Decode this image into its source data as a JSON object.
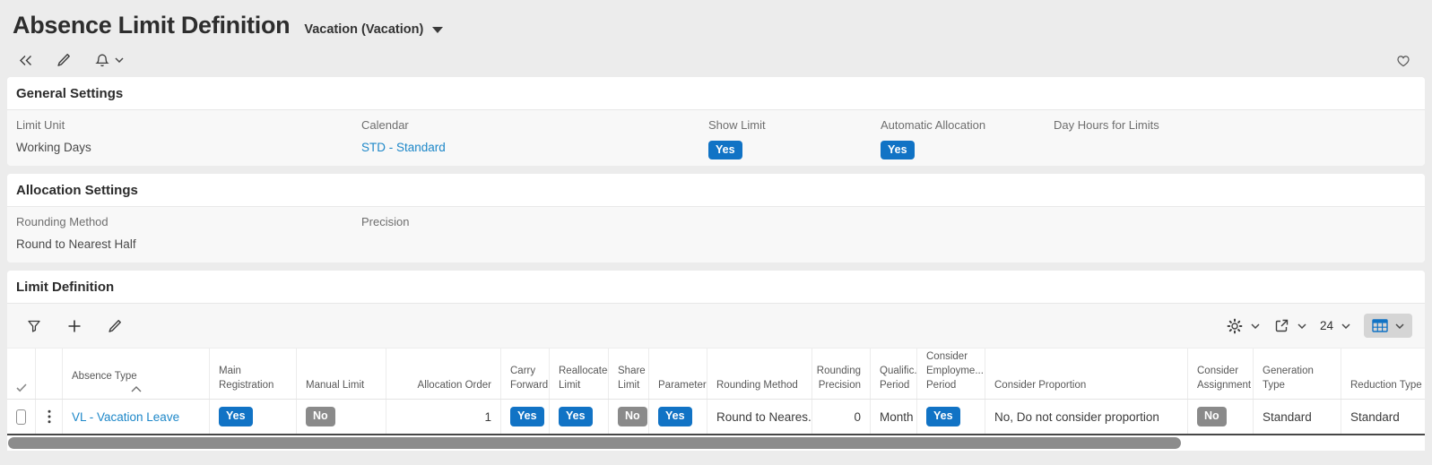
{
  "page": {
    "title": "Absence Limit Definition",
    "context": "Vacation (Vacation)"
  },
  "general_settings": {
    "title": "General Settings",
    "fields": [
      {
        "label": "Limit Unit",
        "value": "Working Days",
        "type": "text"
      },
      {
        "label": "Calendar",
        "value": "STD - Standard",
        "type": "link"
      },
      {
        "label": "Show Limit",
        "value": "Yes",
        "type": "badge"
      },
      {
        "label": "Automatic Allocation",
        "value": "Yes",
        "type": "badge"
      },
      {
        "label": "Day Hours for Limits",
        "value": "",
        "type": "text"
      }
    ]
  },
  "allocation_settings": {
    "title": "Allocation Settings",
    "fields": [
      {
        "label": "Rounding Method",
        "value": "Round to Nearest Half",
        "type": "text"
      },
      {
        "label": "Precision",
        "value": "",
        "type": "text"
      }
    ]
  },
  "limit_definition": {
    "title": "Limit Definition",
    "toolbar": {
      "page_size": "24"
    },
    "table": {
      "columns": [
        "",
        "",
        "Absence Type",
        "Main Registration",
        "Manual Limit",
        "Allocation Order",
        "Carry Forward",
        "Reallocated Limit",
        "Share Limit",
        "Parameters",
        "Rounding Method",
        "Rounding Precision",
        "Qualific... Period",
        "Consider Employme... Period",
        "Consider Proportion",
        "Consider Assignment",
        "Generation Type",
        "Reduction Type"
      ],
      "sorted_column": "Absence Type",
      "row": {
        "absence_type": "VL - Vacation Leave",
        "main_registration": "Yes",
        "manual_limit": "No",
        "allocation_order": "1",
        "carry_forward": "Yes",
        "reallocated_limit": "Yes",
        "share_limit": "No",
        "parameters": "Yes",
        "rounding_method": "Round to Neares...",
        "rounding_precision": "0",
        "qualification_period": "Month",
        "consider_employment_period": "Yes",
        "consider_proportion": "No, Do not consider proportion",
        "consider_assignment": "No",
        "generation_type": "Standard",
        "reduction_type": "Standard"
      }
    }
  },
  "icons": {
    "select_all_check": "✓",
    "row_menu_kebab": "⋮"
  },
  "colors": {
    "badge_yes": "#1173c5",
    "badge_no": "#8a8a8a",
    "link": "#1d87c8",
    "grid_view_active_bg": "#d5d5d5"
  }
}
